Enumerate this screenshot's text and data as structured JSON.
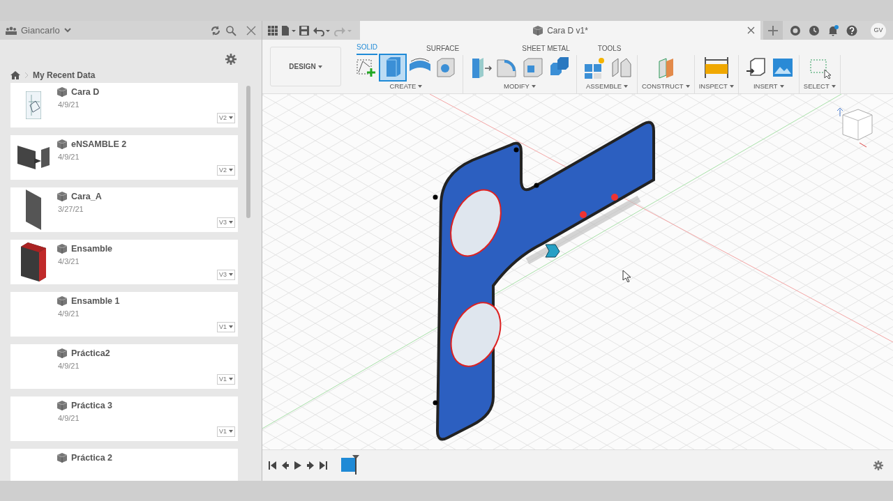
{
  "data_panel": {
    "user": "Giancarlo",
    "breadcrumb": "My Recent Data",
    "files": [
      {
        "name": "Cara D",
        "date": "4/9/21",
        "version": "V2",
        "kind": "sketch"
      },
      {
        "name": "eNSAMBLE 2",
        "date": "4/9/21",
        "version": "V2",
        "kind": "panels"
      },
      {
        "name": "Cara_A",
        "date": "3/27/21",
        "version": "V3",
        "kind": "plate"
      },
      {
        "name": "Ensamble",
        "date": "4/3/21",
        "version": "V3",
        "kind": "box"
      },
      {
        "name": "Ensamble 1",
        "date": "4/9/21",
        "version": "V1",
        "kind": "none"
      },
      {
        "name": "Práctica2",
        "date": "4/9/21",
        "version": "V1",
        "kind": "none"
      },
      {
        "name": "Práctica 3",
        "date": "4/9/21",
        "version": "V1",
        "kind": "none"
      },
      {
        "name": "Práctica 2",
        "kind": "none"
      }
    ]
  },
  "document_tab": {
    "title": "Cara D v1*"
  },
  "profile": {
    "initials": "GV"
  },
  "toolbar": {
    "workspace": "DESIGN",
    "tabs": [
      {
        "label": "SOLID",
        "selected": true
      },
      {
        "label": "SURFACE",
        "selected": false
      },
      {
        "label": "SHEET METAL",
        "selected": false
      },
      {
        "label": "TOOLS",
        "selected": false
      }
    ],
    "groups": [
      {
        "label": "CREATE",
        "tools": [
          {
            "kind": "sketch",
            "selected": false
          },
          {
            "kind": "extrude",
            "selected": true
          },
          {
            "kind": "revolve",
            "selected": false
          },
          {
            "kind": "hole",
            "selected": false
          }
        ]
      },
      {
        "label": "MODIFY",
        "tools": [
          {
            "kind": "presspull",
            "selected": false
          },
          {
            "kind": "fillet",
            "selected": false
          },
          {
            "kind": "shell",
            "selected": false
          },
          {
            "kind": "combine",
            "selected": false
          }
        ]
      },
      {
        "label": "ASSEMBLE",
        "tools": [
          {
            "kind": "component",
            "selected": false
          },
          {
            "kind": "joint",
            "selected": false
          }
        ]
      },
      {
        "label": "CONSTRUCT",
        "tools": [
          {
            "kind": "plane",
            "selected": false
          }
        ]
      },
      {
        "label": "INSPECT",
        "tools": [
          {
            "kind": "measure",
            "selected": false
          }
        ]
      },
      {
        "label": "INSERT",
        "tools": [
          {
            "kind": "derive",
            "selected": false
          },
          {
            "kind": "canvas",
            "selected": false
          }
        ]
      },
      {
        "label": "SELECT",
        "tools": [
          {
            "kind": "select",
            "selected": false
          }
        ]
      }
    ]
  }
}
